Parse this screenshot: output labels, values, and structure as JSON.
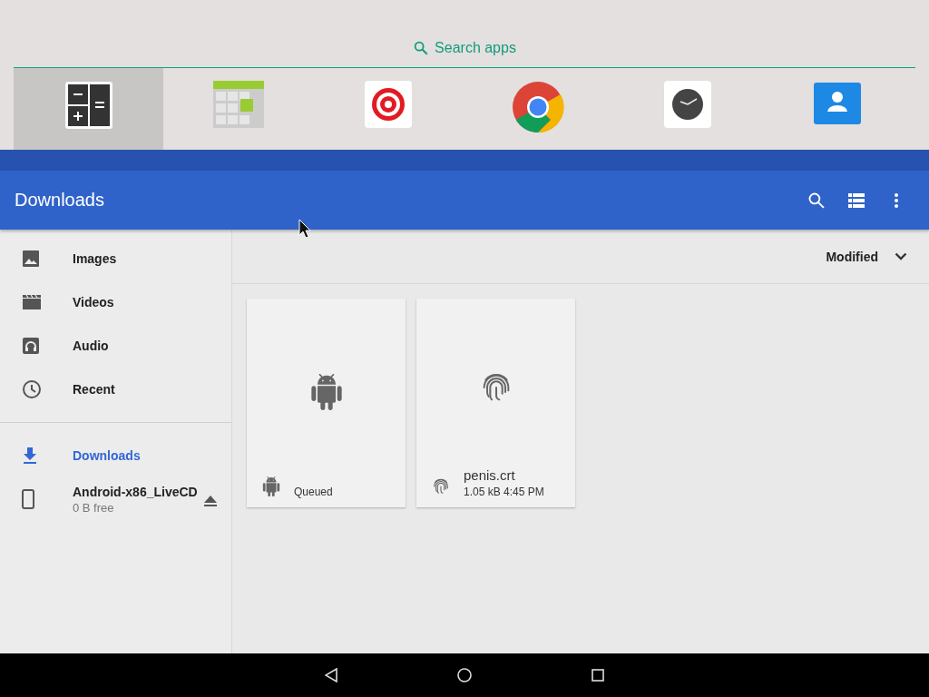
{
  "launcher": {
    "search_label": "Search apps",
    "apps": [
      {
        "kind": "calculator",
        "selected": true
      },
      {
        "kind": "calendar",
        "selected": false
      },
      {
        "kind": "target",
        "selected": false
      },
      {
        "kind": "browser",
        "selected": false
      },
      {
        "kind": "clock",
        "selected": false
      },
      {
        "kind": "contacts",
        "selected": false
      }
    ]
  },
  "toolbar": {
    "title": "Downloads",
    "actions": [
      {
        "kind": "search"
      },
      {
        "kind": "list"
      },
      {
        "kind": "more"
      }
    ]
  },
  "sidebar": {
    "sections": [
      [
        {
          "kind": "image",
          "label": "Images",
          "selected": false
        },
        {
          "kind": "video",
          "label": "Videos",
          "selected": false
        },
        {
          "kind": "audio",
          "label": "Audio",
          "selected": false
        },
        {
          "kind": "recent",
          "label": "Recent",
          "selected": false
        }
      ],
      [
        {
          "kind": "download",
          "label": "Downloads",
          "selected": true
        },
        {
          "kind": "device",
          "label": "Android-x86_LiveCD",
          "subtitle": "0 B free",
          "ejectable": true,
          "selected": false
        }
      ]
    ]
  },
  "sort": {
    "label": "Modified"
  },
  "files": [
    {
      "kind": "android",
      "summary": "Queued"
    },
    {
      "kind": "fingerprint",
      "title": "penis.crt",
      "summary": "1.05 kB 4:45 PM"
    }
  ],
  "nav": [
    {
      "kind": "back"
    },
    {
      "kind": "home"
    },
    {
      "kind": "recents"
    }
  ]
}
